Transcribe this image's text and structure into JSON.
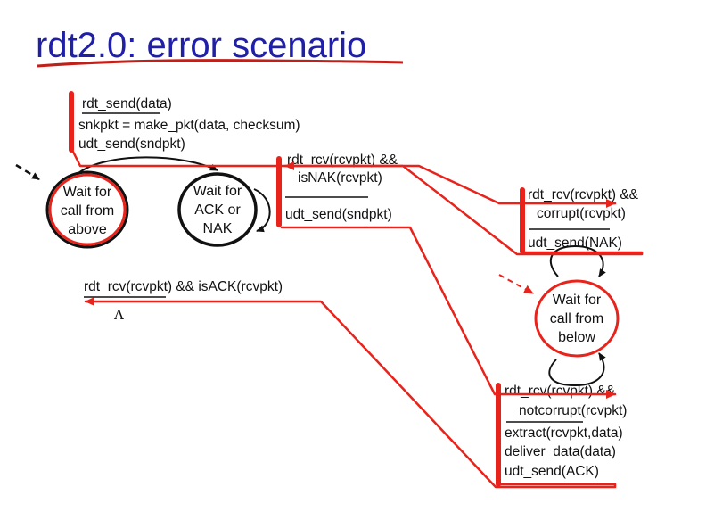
{
  "title": "rdt2.0: error scenario",
  "colors": {
    "title": "#1f1fa8",
    "highlight": "#e8231b",
    "underline": "#c0201a",
    "ink": "#111111"
  },
  "sender": {
    "state_call": [
      "Wait for",
      "call from",
      "above"
    ],
    "state_ack": [
      "Wait for",
      "ACK or",
      "NAK"
    ],
    "t_send": {
      "event": "rdt_send(data)",
      "actions": [
        "snkpkt = make_pkt(data, checksum)",
        "udt_send(sndpkt)"
      ]
    },
    "t_nak": {
      "event": [
        "rdt_rcv(rcvpkt) &&",
        "isNAK(rcvpkt)"
      ],
      "action": "udt_send(sndpkt)"
    },
    "t_ack": {
      "event": "rdt_rcv(rcvpkt) && isACK(rcvpkt)",
      "action": "Λ"
    }
  },
  "receiver": {
    "state_below": [
      "Wait for",
      "call from",
      "below"
    ],
    "t_corrupt": {
      "event": [
        "rdt_rcv(rcvpkt) &&",
        "corrupt(rcvpkt)"
      ],
      "action": "udt_send(NAK)"
    },
    "t_ok": {
      "event": [
        "rdt_rcv(rcvpkt) &&",
        "notcorrupt(rcvpkt)"
      ],
      "actions": [
        "extract(rcvpkt,data)",
        "deliver_data(data)",
        "udt_send(ACK)"
      ]
    }
  }
}
